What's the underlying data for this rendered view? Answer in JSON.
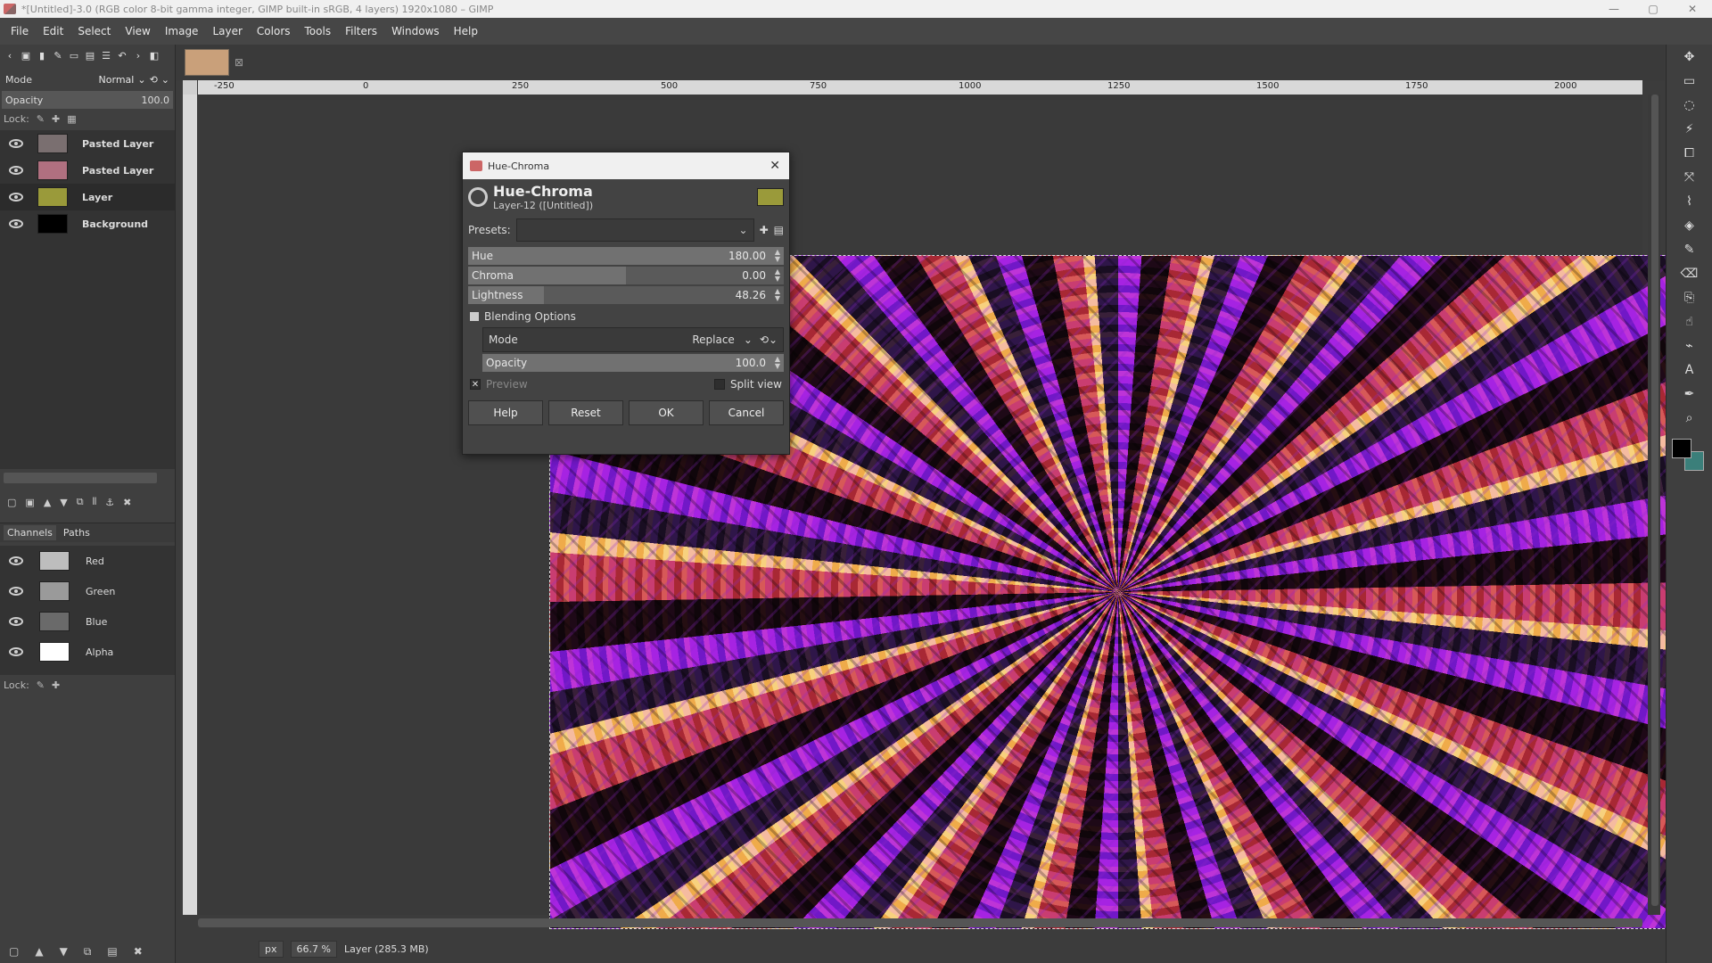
{
  "window": {
    "title": "*[Untitled]-3.0 (RGB color 8-bit gamma integer, GIMP built-in sRGB, 4 layers) 1920x1080 – GIMP",
    "controls": [
      "—",
      "▢",
      "✕"
    ]
  },
  "menu": [
    "File",
    "Edit",
    "Select",
    "View",
    "Image",
    "Layer",
    "Colors",
    "Tools",
    "Filters",
    "Windows",
    "Help"
  ],
  "layers_panel": {
    "mode_label": "Mode",
    "mode_value": "Normal",
    "opacity_label": "Opacity",
    "opacity_value": "100.0",
    "lock_label": "Lock:",
    "layers": [
      {
        "name": "Pasted Layer",
        "thumb": "#7a6f70"
      },
      {
        "name": "Pasted Layer",
        "thumb": "#b07080"
      },
      {
        "name": "Layer",
        "thumb": "#9a9a3a"
      },
      {
        "name": "Background",
        "thumb": "#000000"
      }
    ]
  },
  "channels_panel": {
    "tabs": [
      "Channels",
      "Paths"
    ],
    "channels": [
      {
        "name": "Red",
        "thumb": "#bdbdbd"
      },
      {
        "name": "Green",
        "thumb": "#9a9a9a"
      },
      {
        "name": "Blue",
        "thumb": "#6a6a6a"
      },
      {
        "name": "Alpha",
        "thumb": "#ffffff"
      }
    ],
    "lock_label": "Lock:"
  },
  "ruler": {
    "ticks": [
      "-250",
      "0",
      "250",
      "500",
      "750",
      "1000",
      "1250",
      "1500",
      "1750",
      "2000"
    ]
  },
  "statusbar": {
    "unit": "px",
    "zoom": "66.7 %",
    "info": "Layer (285.3 MB)"
  },
  "dialog": {
    "window_title": "Hue-Chroma",
    "heading": "Hue-Chroma",
    "subheading": "Layer-12 ([Untitled])",
    "presets_label": "Presets:",
    "sliders": [
      {
        "label": "Hue",
        "value": "180.00",
        "fill_percent": 100
      },
      {
        "label": "Chroma",
        "value": "0.00",
        "fill_percent": 50
      },
      {
        "label": "Lightness",
        "value": "48.26",
        "fill_percent": 24
      }
    ],
    "blending_label": "Blending Options",
    "mode_label": "Mode",
    "mode_value": "Replace",
    "opacity_label": "Opacity",
    "opacity_value": "100.0",
    "preview_label": "Preview",
    "split_label": "Split view",
    "buttons": [
      "Help",
      "Reset",
      "OK",
      "Cancel"
    ]
  },
  "colors": {
    "foreground": "#000000",
    "background": "#3b7f7a"
  }
}
